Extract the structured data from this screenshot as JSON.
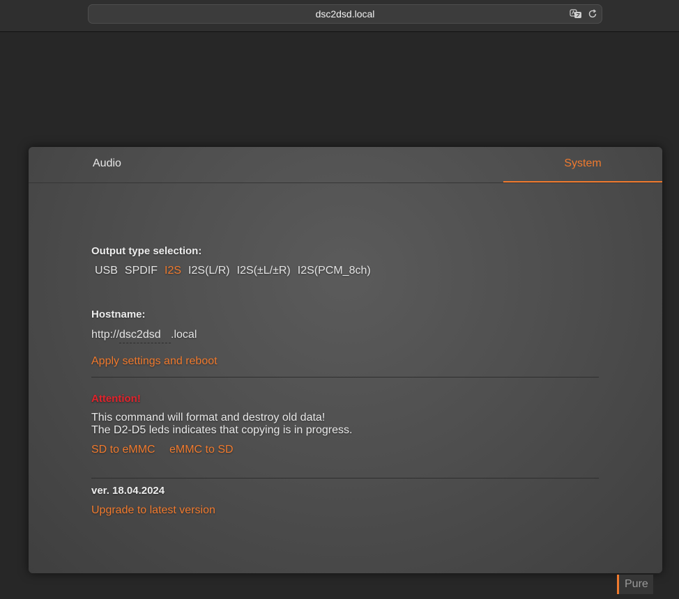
{
  "browser": {
    "url": "dsc2dsd.local",
    "icons": [
      "translate-icon",
      "reload-icon"
    ]
  },
  "tabs": [
    {
      "label": "Audio",
      "active": false
    },
    {
      "label": "System",
      "active": true
    }
  ],
  "output": {
    "label": "Output type selection:",
    "options": [
      "USB",
      "SPDIF",
      "I2S",
      "I2S(L/R)",
      "I2S(±L/±R)",
      "I2S(PCM_8ch)"
    ],
    "selected": "I2S"
  },
  "hostname": {
    "label": "Hostname:",
    "prefix": "http://",
    "value": "dsc2dsd",
    "suffix": ".local",
    "apply_label": "Apply settings and reboot"
  },
  "attention": {
    "title": "Attention!",
    "line1": "This command will format and destroy old data!",
    "line2": "The D2-D5 leds indicates that copying is in progress.",
    "sd_to_emmc": "SD to eMMC",
    "emmc_to_sd": "eMMC to SD"
  },
  "version": {
    "label": "ver. 18.04.2024",
    "upgrade_label": "Upgrade to latest version"
  },
  "footer": {
    "pure_label": "Pure"
  },
  "colors": {
    "accent": "#f07a2e",
    "danger": "#e1232c"
  }
}
